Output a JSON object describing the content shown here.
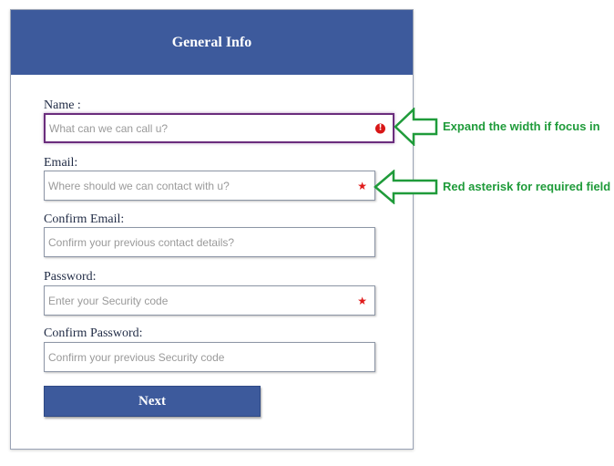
{
  "form": {
    "title": "General Info",
    "fields": [
      {
        "label": "Name :",
        "placeholder": "What can we can call u?",
        "indicator": "error-icon",
        "state": "focused"
      },
      {
        "label": "Email:",
        "placeholder": "Where should we can contact with u?",
        "indicator": "required-asterisk"
      },
      {
        "label": "Confirm Email:",
        "placeholder": "Confirm your previous contact details?",
        "indicator": "none"
      },
      {
        "label": "Password:",
        "placeholder": "Enter your Security code",
        "indicator": "required-asterisk"
      },
      {
        "label": "Confirm Password:",
        "placeholder": "Confirm your previous Security code",
        "indicator": "none"
      }
    ],
    "required_mark": "★",
    "error_mark": "!",
    "next_label": "Next"
  },
  "annotations": {
    "focus_note": "Expand the width if focus in",
    "required_note": "Red asterisk for required field"
  },
  "colors": {
    "header_bg": "#3d5a9c",
    "button_bg": "#3d5a9c",
    "focus_border": "#6b2d7d",
    "required_red": "#e01b1b",
    "annotation_green": "#1f9b3a"
  }
}
